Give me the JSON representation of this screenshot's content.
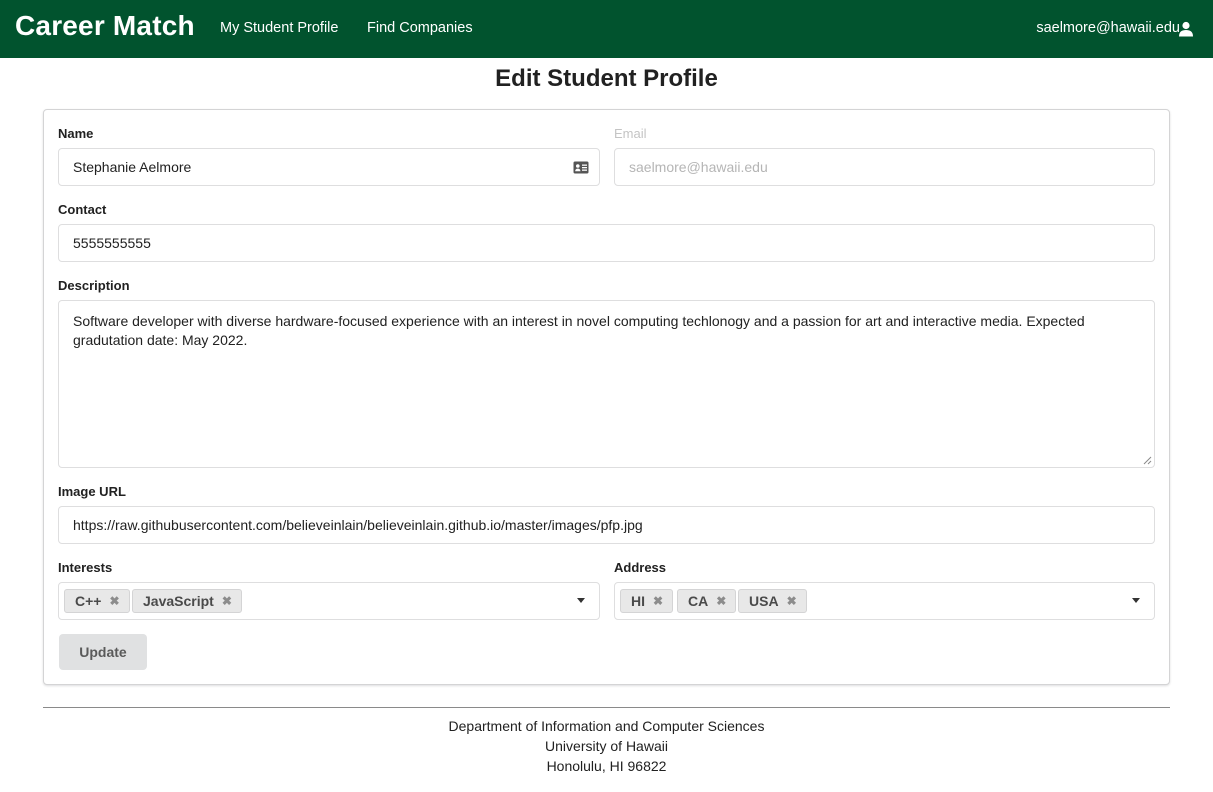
{
  "navbar": {
    "brand": "Career Match",
    "links": [
      "My Student Profile",
      "Find Companies"
    ],
    "user_email": "saelmore@hawaii.edu",
    "user_icon": "user-icon",
    "bg_color": "#01532e"
  },
  "page": {
    "title": "Edit Student Profile"
  },
  "form": {
    "name_label": "Name",
    "name_value": "Stephanie Aelmore",
    "name_icon": "id-card-icon",
    "email_label": "Email",
    "email_value": "saelmore@hawaii.edu",
    "contact_label": "Contact",
    "contact_value": "5555555555",
    "description_label": "Description",
    "description_value": "Software developer with diverse hardware-focused experience with an interest in novel computing techlonogy and a passion for art and interactive media. Expected gradutation date: May 2022.",
    "image_url_label": "Image URL",
    "image_url_value": "https://raw.githubusercontent.com/believeinlain/believeinlain.github.io/master/images/pfp.jpg",
    "interests_label": "Interests",
    "interests": [
      "C++",
      "JavaScript"
    ],
    "address_label": "Address",
    "address": [
      "HI",
      "CA",
      "USA"
    ],
    "update_button": "Update"
  },
  "footer": {
    "lines": [
      "Department of Information and Computer Sciences",
      "University of Hawaii",
      "Honolulu, HI 96822"
    ]
  }
}
